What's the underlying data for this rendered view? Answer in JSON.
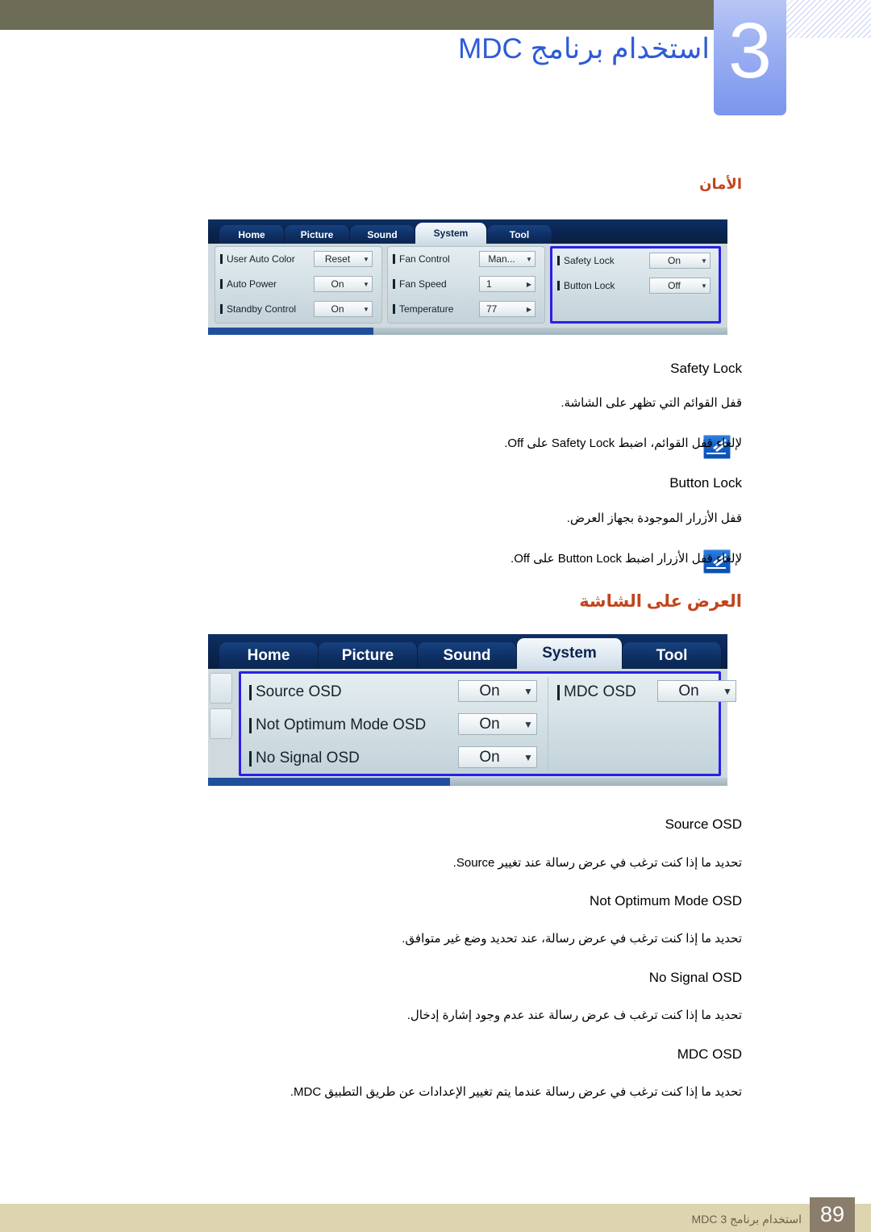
{
  "header": {
    "chapter_number": "3",
    "chapter_title": "استخدام برنامج MDC"
  },
  "sections": [
    {
      "heading": "الأمان",
      "screenshot": {
        "tabs": [
          "Home",
          "Picture",
          "Sound",
          "System",
          "Tool"
        ],
        "active_tab": "System",
        "panes": [
          {
            "highlighted": false,
            "rows": [
              {
                "label": "User Auto Color",
                "value": "Reset",
                "arrow": "▼"
              },
              {
                "label": "Auto Power",
                "value": "On",
                "arrow": "▼"
              },
              {
                "label": "Standby Control",
                "value": "On",
                "arrow": "▼"
              }
            ]
          },
          {
            "highlighted": false,
            "rows": [
              {
                "label": "Fan Control",
                "value": "Man...",
                "arrow": "▼"
              },
              {
                "label": "Fan Speed",
                "value": "1",
                "arrow": "▶"
              },
              {
                "label": "Temperature",
                "value": "77",
                "arrow": "▶"
              }
            ]
          },
          {
            "highlighted": true,
            "rows": [
              {
                "label": "Safety Lock",
                "value": "On",
                "arrow": "▼"
              },
              {
                "label": "Button Lock",
                "value": "Off",
                "arrow": "▼"
              }
            ]
          }
        ]
      },
      "entries": [
        {
          "term": "Safety Lock",
          "description": "قفل القوائم التي تظهر على الشاشة.",
          "note": "لإلغاء قفل القوائم، اضبط Safety Lock على Off.",
          "has_note_icon": true
        },
        {
          "term": "Button Lock",
          "description": "قفل الأزرار الموجودة بجهاز العرض.",
          "note": "لإلغاء قفل الأزرار اضبط Button Lock على Off.",
          "has_note_icon": true
        }
      ]
    },
    {
      "heading": "العرض على الشاشة",
      "screenshot": {
        "tabs": [
          "Home",
          "Picture",
          "Sound",
          "System",
          "Tool"
        ],
        "active_tab": "System",
        "panes": [
          {
            "highlighted": true,
            "rows": [
              {
                "label": "Source OSD",
                "value": "On",
                "arrow": "▼"
              },
              {
                "label": "Not Optimum Mode OSD",
                "value": "On",
                "arrow": "▼"
              },
              {
                "label": "No Signal OSD",
                "value": "On",
                "arrow": "▼"
              }
            ]
          },
          {
            "highlighted": false,
            "rows": [
              {
                "label": "MDC OSD",
                "value": "On",
                "arrow": "▼"
              }
            ]
          }
        ]
      },
      "entries": [
        {
          "term": "Source OSD",
          "description": "تحديد ما إذا كنت ترغب في عرض رسالة عند تغيير Source.",
          "has_note_icon": false
        },
        {
          "term": "Not Optimum Mode OSD",
          "description": "تحديد ما إذا كنت ترغب في عرض رسالة، عند تحديد وضع غير متوافق.",
          "has_note_icon": false
        },
        {
          "term": "No Signal OSD",
          "description": "تحديد ما إذا كنت ترغب ف عرض رسالة عند عدم وجود إشارة إدخال.",
          "has_note_icon": false
        },
        {
          "term": "MDC OSD",
          "description": "تحديد ما إذا كنت ترغب في عرض رسالة عندما يتم تغيير الإعدادات عن طريق التطبيق MDC.",
          "has_note_icon": false
        }
      ]
    }
  ],
  "footer": {
    "page_number": "89",
    "text": "استخدام برنامج MDC 3"
  },
  "colors": {
    "header_bar": "#6d6c57",
    "chapter_title": "#2e5bd6",
    "section_heading": "#c2451b",
    "footer_band": "#ddd5b0",
    "footer_page_box": "#8b7d6b",
    "highlight_border": "#2a20e6"
  }
}
